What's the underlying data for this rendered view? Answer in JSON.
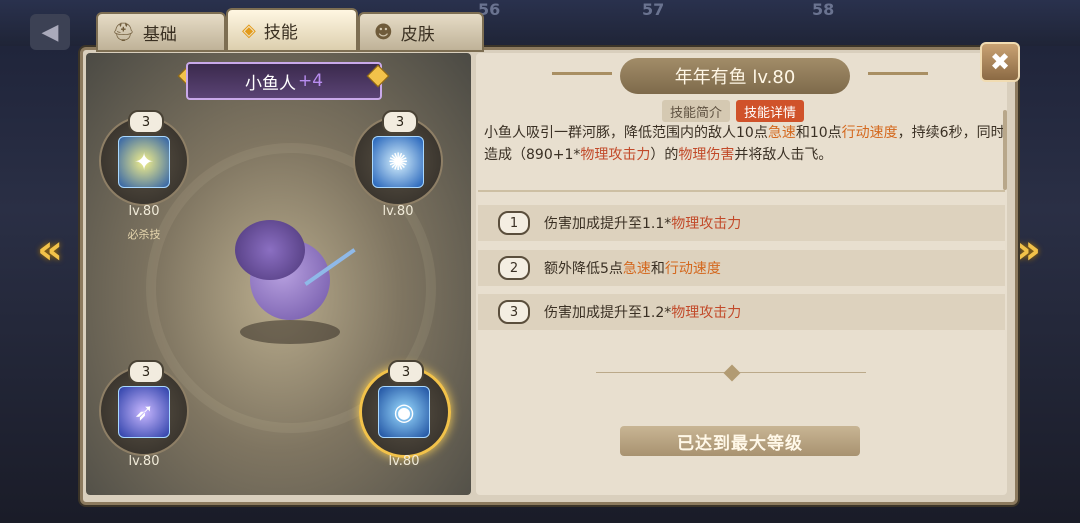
{
  "background": {
    "numbers": [
      "56",
      "57",
      "58"
    ]
  },
  "tabs": [
    {
      "label": "基础",
      "icon": "helmet-icon"
    },
    {
      "label": "技能",
      "icon": "skill-icon"
    },
    {
      "label": "皮肤",
      "icon": "mask-icon"
    }
  ],
  "hero": {
    "name": "小鱼人",
    "plus": "+4"
  },
  "skills": [
    {
      "level_badge": "3",
      "lv": "lv.80",
      "tag": "必杀技",
      "icon": "beast-skill-icon"
    },
    {
      "level_badge": "3",
      "lv": "lv.80",
      "icon": "water-skill-icon"
    },
    {
      "level_badge": "3",
      "lv": "lv.80",
      "icon": "spear-skill-icon"
    },
    {
      "level_badge": "3",
      "lv": "lv.80",
      "icon": "puffer-skill-icon"
    }
  ],
  "detail": {
    "title": "年年有鱼 lv.80",
    "sub_tabs": [
      "技能简介",
      "技能详情"
    ],
    "desc": {
      "p1": "小鱼人吸引一群河豚，降低范围内的敌人10点",
      "k1": "急速",
      "p2": "和10点",
      "k2": "行动速度",
      "p3": "，持续6秒，同时造成（890+1*",
      "k3": "物理攻击力",
      "p4": "）的",
      "k4": "物理伤害",
      "p5": "并将敌人击飞。"
    },
    "upgrades": [
      {
        "num": "1",
        "text": "伤害加成提升至1.1*",
        "hl": "物理攻击力"
      },
      {
        "num": "2",
        "text": "额外降低5点",
        "hl": "急速",
        "text2": "和",
        "hl2": "行动速度"
      },
      {
        "num": "3",
        "text": "伤害加成提升至1.2*",
        "hl": "物理攻击力"
      }
    ],
    "max_level": "已达到最大等级"
  },
  "close_label": "✖"
}
